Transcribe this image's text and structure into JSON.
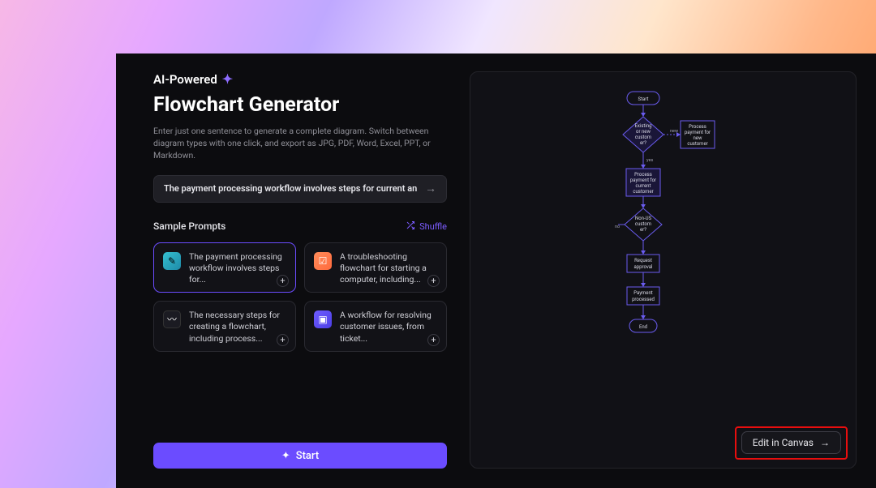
{
  "header": {
    "kicker": "AI-Powered",
    "title": "Flowchart Generator",
    "subtitle": "Enter just one sentence to generate a complete diagram. Switch between diagram types with one click, and export as JPG, PDF, Word, Excel, PPT, or Markdown."
  },
  "prompt": {
    "text": "The payment processing workflow involves steps for current and new customers, inclu"
  },
  "sample": {
    "title": "Sample Prompts",
    "shuffle": "Shuffle",
    "cards": [
      {
        "text": "The payment processing workflow involves steps for..."
      },
      {
        "text": "A troubleshooting flowchart for starting a computer, including..."
      },
      {
        "text": "The necessary steps for creating a flowchart, including process..."
      },
      {
        "text": "A workflow for resolving customer issues, from ticket..."
      }
    ]
  },
  "actions": {
    "start": "Start",
    "edit": "Edit in Canvas"
  },
  "flowchart": {
    "nodes": {
      "start": "Start",
      "decision1_l1": "Existing",
      "decision1_l2": "or new",
      "decision1_l3": "custom",
      "decision1_l4": "er?",
      "proc_new_l1": "Process",
      "proc_new_l2": "payment for",
      "proc_new_l3": "new",
      "proc_new_l4": "customer",
      "proc_cur_l1": "Process",
      "proc_cur_l2": "payment for",
      "proc_cur_l3": "current",
      "proc_cur_l4": "customer",
      "decision2_l1": "Non-US",
      "decision2_l2": "custom",
      "decision2_l3": "er?",
      "req_l1": "Request",
      "req_l2": "approval",
      "done_l1": "Payment",
      "done_l2": "processed",
      "end": "End"
    },
    "labels": {
      "new": "new",
      "yes": "yes",
      "no": "no"
    }
  }
}
